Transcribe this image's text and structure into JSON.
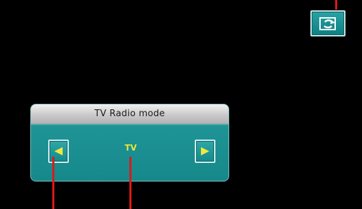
{
  "dialog": {
    "title": "TV Radio mode",
    "current_mode": "TV"
  },
  "icons": {
    "back": "return-icon",
    "prev": "arrow-left-icon",
    "next": "arrow-right-icon"
  },
  "colors": {
    "background": "#000000",
    "panel": "#1a8f91",
    "header": "#d0d0d0",
    "value_text": "#e6e63a",
    "arrow": "#f5e63c",
    "callout": "#e01818"
  }
}
